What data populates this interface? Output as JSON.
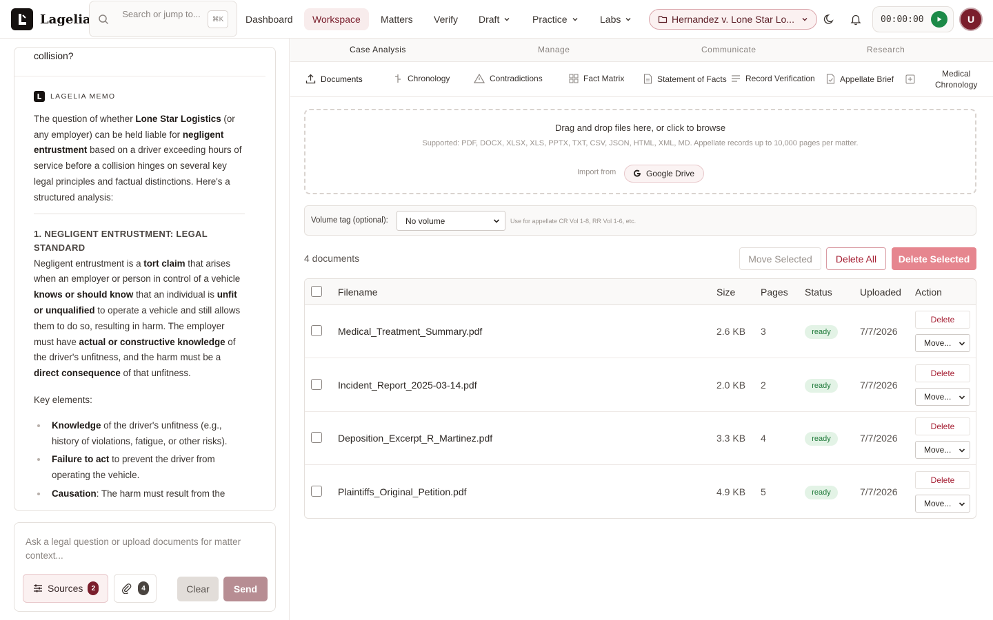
{
  "app": {
    "name": "Lagelia"
  },
  "search": {
    "placeholder": "Search or jump to...",
    "shortcut": "⌘K"
  },
  "nav": [
    {
      "label": "Dashboard",
      "active": false,
      "dropdown": false
    },
    {
      "label": "Workspace",
      "active": true,
      "dropdown": false
    },
    {
      "label": "Matters",
      "active": false,
      "dropdown": false
    },
    {
      "label": "Verify",
      "active": false,
      "dropdown": false
    },
    {
      "label": "Draft",
      "active": false,
      "dropdown": true
    },
    {
      "label": "Practice",
      "active": false,
      "dropdown": true
    },
    {
      "label": "Labs",
      "active": false,
      "dropdown": true
    }
  ],
  "matter": {
    "label": "Hernandez v. Lone Star Lo..."
  },
  "timer": {
    "value": "00:00:00"
  },
  "user": {
    "initial": "U"
  },
  "colors": {
    "accent": "#7a1e2c",
    "ready_bg": "#e3f3e6",
    "ready_text": "#1f7a3a",
    "danger": "#a51e32"
  },
  "chat": {
    "question_tail": "collision?",
    "memo_tag": "LAGELIA MEMO",
    "intro": {
      "t1": "The question of whether ",
      "b1": "Lone Star Logistics",
      "t2": " (or any employer) can be held liable for ",
      "b2": "negligent entrustment",
      "t3": " based on a driver exceeding hours of service before a collision hinges on several key legal principles and factual distinctions. Here's a structured analysis:"
    },
    "section1_heading": "1. NEGLIGENT ENTRUSTMENT: LEGAL STANDARD",
    "section1": {
      "t1": "Negligent entrustment is a ",
      "b1": "tort claim",
      "t2": " that arises when an employer or person in control of a vehicle ",
      "b2": "knows or should know",
      "t3": " that an individual is ",
      "b3": "unfit or unqualified",
      "t4": " to operate a vehicle and still allows them to do so, resulting in harm. The employer must have ",
      "b4": "actual or constructive knowledge",
      "t5": " of the driver's unfitness, and the harm must be a ",
      "b5": "direct consequence",
      "t6": " of that unfitness."
    },
    "key_elements_label": "Key elements:",
    "elements": [
      {
        "bold": "Knowledge",
        "text": " of the driver's unfitness (e.g., history of violations, fatigue, or other risks)."
      },
      {
        "bold": "Failure to act",
        "text": " to prevent the driver from operating the vehicle."
      },
      {
        "bold": "Causation",
        "text": ": The harm must result from the"
      }
    ],
    "composer_placeholder": "Ask a legal question or upload documents for matter context...",
    "sources_label": "Sources",
    "sources_count": "2",
    "attach_count": "4",
    "clear_label": "Clear",
    "send_label": "Send"
  },
  "section_tabs": [
    {
      "label": "Case Analysis",
      "active": true
    },
    {
      "label": "Manage",
      "active": false
    },
    {
      "label": "Communicate",
      "active": false
    },
    {
      "label": "Research",
      "active": false
    }
  ],
  "tool_tabs": [
    {
      "label": "Documents",
      "icon": "upload-icon",
      "active": true
    },
    {
      "label": "Chronology",
      "icon": "timeline-icon",
      "active": false
    },
    {
      "label": "Contradictions",
      "icon": "warning-icon",
      "active": false
    },
    {
      "label": "Fact Matrix",
      "icon": "grid-icon",
      "active": false
    },
    {
      "label": "Statement of Facts",
      "icon": "file-text-icon",
      "active": false
    },
    {
      "label": "Record Verification",
      "icon": "list-check-icon",
      "active": false
    },
    {
      "label": "Appellate Brief",
      "icon": "file-icon",
      "active": false
    },
    {
      "label": "Medical",
      "label2": "Chronology",
      "icon": "plus-square-icon",
      "active": false
    }
  ],
  "dropzone": {
    "title": "Drag and drop files here, or click to browse",
    "supported": "Supported: PDF, DOCX, XLSX, XLS, PPTX, TXT, CSV, JSON, HTML, XML, MD. Appellate records up to 10,000 pages per matter.",
    "import_from": "Import from",
    "google_drive": "Google Drive"
  },
  "volume": {
    "label": "Volume tag (optional):",
    "selected": "No volume",
    "hint": "Use for appellate CR Vol 1-8, RR Vol 1-6, etc."
  },
  "documents": {
    "count_label": "4 documents",
    "move_selected": "Move Selected",
    "delete_all": "Delete All",
    "delete_selected": "Delete Selected",
    "columns": {
      "filename": "Filename",
      "size": "Size",
      "pages": "Pages",
      "status": "Status",
      "uploaded": "Uploaded",
      "action": "Action"
    },
    "row_delete": "Delete",
    "row_move": "Move...",
    "rows": [
      {
        "filename": "Medical_Treatment_Summary.pdf",
        "size": "2.6 KB",
        "pages": "3",
        "status": "ready",
        "uploaded": "7/7/2026"
      },
      {
        "filename": "Incident_Report_2025-03-14.pdf",
        "size": "2.0 KB",
        "pages": "2",
        "status": "ready",
        "uploaded": "7/7/2026"
      },
      {
        "filename": "Deposition_Excerpt_R_Martinez.pdf",
        "size": "3.3 KB",
        "pages": "4",
        "status": "ready",
        "uploaded": "7/7/2026"
      },
      {
        "filename": "Plaintiffs_Original_Petition.pdf",
        "size": "4.9 KB",
        "pages": "5",
        "status": "ready",
        "uploaded": "7/7/2026"
      }
    ]
  }
}
